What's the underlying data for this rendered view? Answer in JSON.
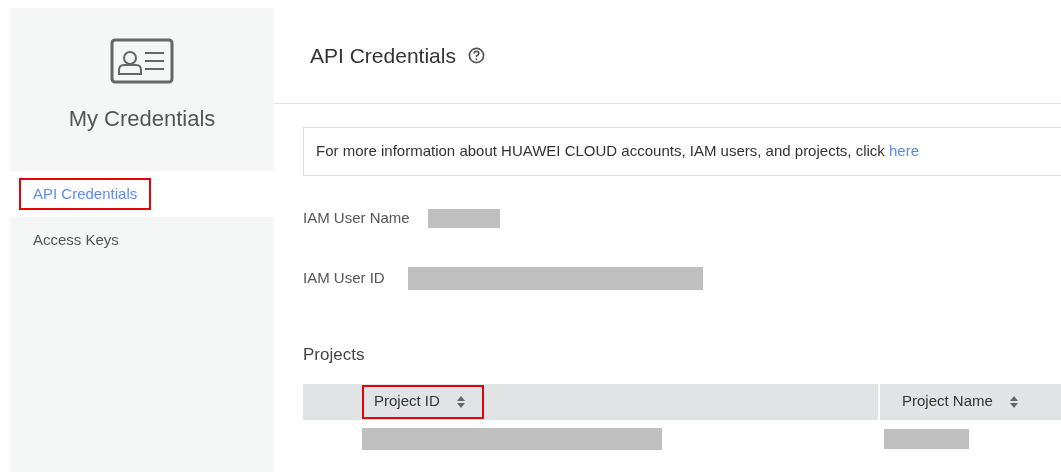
{
  "sidebar": {
    "title": "My Credentials",
    "items": [
      {
        "label": "API Credentials",
        "selected": true,
        "highlighted": true
      },
      {
        "label": "Access Keys",
        "selected": false,
        "highlighted": false
      }
    ]
  },
  "page": {
    "title": "API Credentials"
  },
  "notice": {
    "text": "For more information about HUAWEI CLOUD accounts, IAM users, and projects, click",
    "link": "here"
  },
  "fields": [
    {
      "label": "IAM User Name",
      "redacted": true
    },
    {
      "label": "IAM User ID",
      "redacted": true
    }
  ],
  "projects": {
    "title": "Projects",
    "columns": [
      {
        "label": "Project ID",
        "highlighted": true
      },
      {
        "label": "Project Name",
        "highlighted": false
      }
    ],
    "rows": [
      {
        "redacted": [
          true,
          true
        ]
      }
    ]
  }
}
